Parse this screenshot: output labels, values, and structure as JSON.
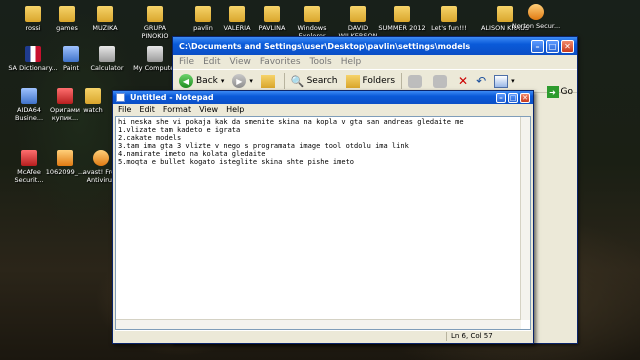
{
  "desktop": {
    "icons": [
      {
        "label": "rossi",
        "icon": "folder-icon"
      },
      {
        "label": "games",
        "icon": "folder-icon"
      },
      {
        "label": "MUZIKA",
        "icon": "folder-icon"
      },
      {
        "label": "GRUPA PINOKIO",
        "icon": "folder-icon"
      },
      {
        "label": "pavlin",
        "icon": "folder-icon"
      },
      {
        "label": "VALERIA",
        "icon": "folder-icon"
      },
      {
        "label": "PAVLINA",
        "icon": "folder-icon"
      },
      {
        "label": "Windows Explorer",
        "icon": "explorer-icon"
      },
      {
        "label": "DAVID WILKERSON",
        "icon": "folder-icon"
      },
      {
        "label": "SUMMER 2012",
        "icon": "folder-icon"
      },
      {
        "label": "Let's fun!!!",
        "icon": "folder-icon"
      },
      {
        "label": "ALISON KRAUS",
        "icon": "folder-icon"
      },
      {
        "label": "Norton Secur...",
        "icon": "norton-icon"
      },
      {
        "label": "SA Dictionary...",
        "icon": "dictionary-icon"
      },
      {
        "label": "Paint",
        "icon": "paint-icon"
      },
      {
        "label": "Calculator",
        "icon": "calculator-icon"
      },
      {
        "label": "My Computer",
        "icon": "computer-icon"
      },
      {
        "label": "AIDA64 Busine...",
        "icon": "aida64-icon"
      },
      {
        "label": "Оригами купик...",
        "icon": "document-icon"
      },
      {
        "label": "watch",
        "icon": "folder-icon"
      },
      {
        "label": "McAfee Securit...",
        "icon": "mcafee-icon"
      },
      {
        "label": "1062099_...",
        "icon": "image-icon"
      },
      {
        "label": "avast! Free Antivirus",
        "icon": "avast-icon"
      }
    ]
  },
  "explorer": {
    "title": "C:\\Documents and Settings\\user\\Desktop\\pavlin\\settings\\models",
    "menu": [
      "File",
      "Edit",
      "View",
      "Favorites",
      "Tools",
      "Help"
    ],
    "toolbar": {
      "back_label": "Back",
      "search_label": "Search",
      "folders_label": "Folders"
    },
    "go_label": "Go"
  },
  "notepad": {
    "title": "Untitled - Notepad",
    "menu": [
      "File",
      "Edit",
      "Format",
      "View",
      "Help"
    ],
    "lines": [
      "hi neska she vi pokaja kak da smenite skina na kopla v gta san andreas gledaite me",
      "1.vlizate tam kadeto e igrata",
      "2.cakate models",
      "3.tam ima gta 3 vlizte v nego s programata image tool otdolu ima link",
      "4.namirate imeto na kolata gledaite",
      "5.moqta e bullet kogato isteglite skina shte pishe imeto"
    ],
    "status": "Ln 6, Col 57"
  }
}
